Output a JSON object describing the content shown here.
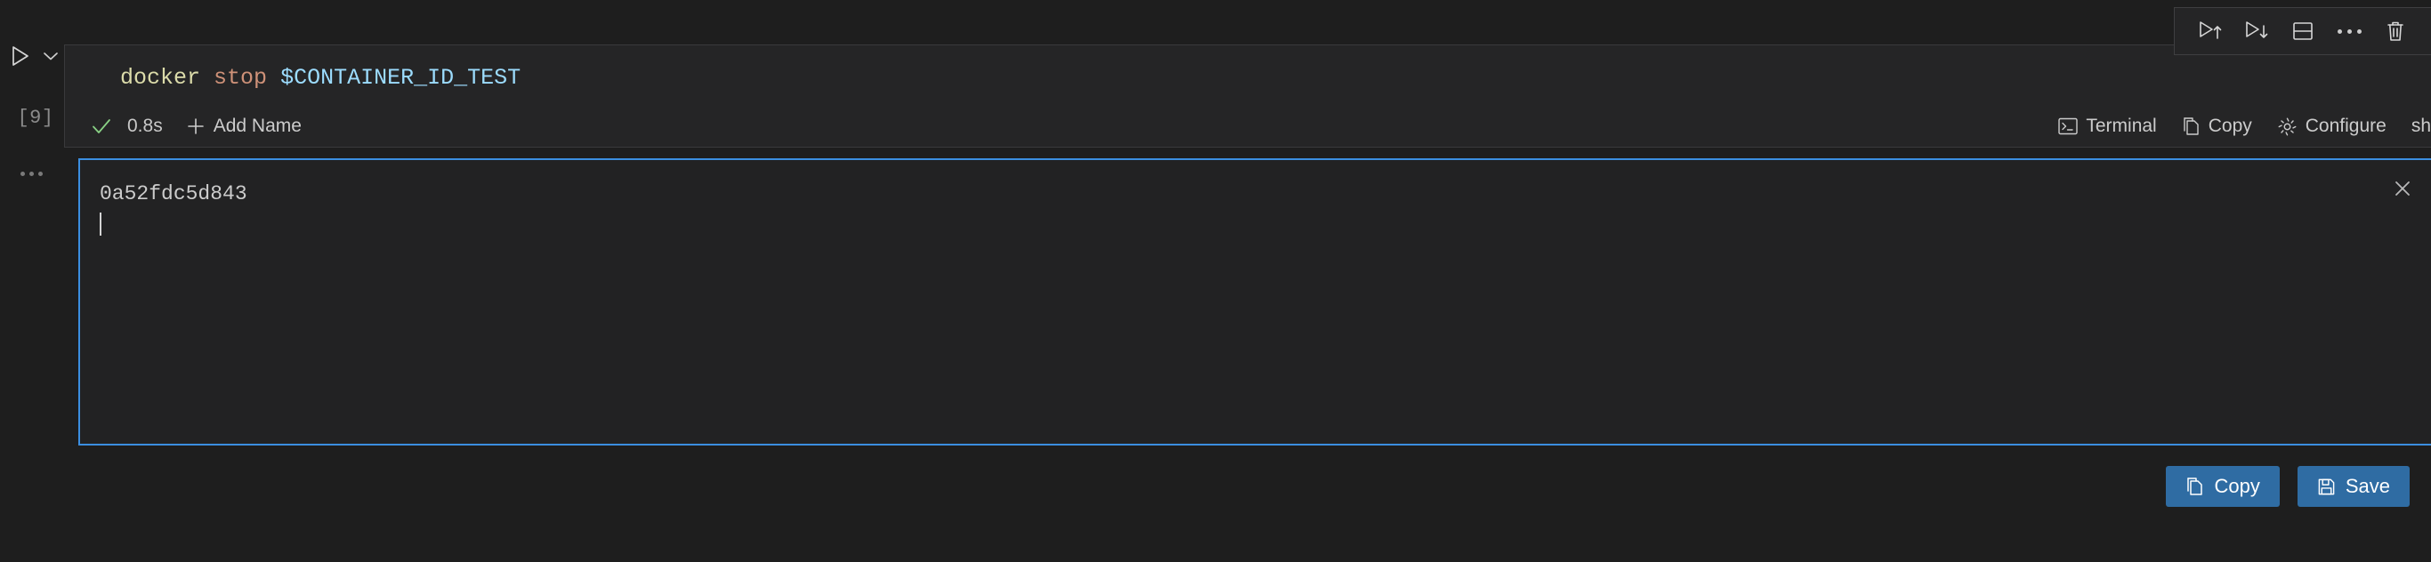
{
  "theme": {
    "page_bg": "#1e1e1e",
    "cell_bg": "#252526",
    "output_bg": "#222223",
    "focus_border": "#3b8ee0",
    "accent_button": "#2f6ca3",
    "text": "#cccccc",
    "muted_text": "#8b8b8b",
    "success": "#89d185",
    "syntax_command": "#dcdcaa",
    "syntax_argument": "#ce9178",
    "syntax_variable": "#9cdcfe"
  },
  "gutter": {
    "run_icon": "play-triangle-icon",
    "chevron_icon": "chevron-down-icon",
    "execution_count": "[9]",
    "more_icon": "ellipsis-icon"
  },
  "cell_toolbar": {
    "buttons": [
      {
        "name": "run-cells-above-button",
        "icon": "play-arrow-up-icon"
      },
      {
        "name": "run-cells-below-button",
        "icon": "play-arrow-down-icon"
      },
      {
        "name": "split-cell-button",
        "icon": "split-cell-icon"
      },
      {
        "name": "more-actions-button",
        "icon": "ellipsis-icon"
      },
      {
        "name": "delete-cell-button",
        "icon": "trash-icon"
      }
    ]
  },
  "code_cell": {
    "tokens": {
      "command": "docker",
      "argument": "stop",
      "variable": "$CONTAINER_ID_TEST"
    },
    "full_text": "docker stop $CONTAINER_ID_TEST"
  },
  "cell_status": {
    "success_icon": "checkmark-icon",
    "duration": "0.8s",
    "add_name_icon": "plus-icon",
    "add_name_label": "Add Name",
    "terminal_icon": "terminal-icon",
    "terminal_label": "Terminal",
    "copy_icon": "copy-icon",
    "copy_label": "Copy",
    "configure_icon": "gear-icon",
    "configure_label": "Configure",
    "kernel_label": "sh"
  },
  "output": {
    "text": "0a52fdc5d843",
    "close_icon": "close-icon"
  },
  "actions": {
    "copy": {
      "label": "Copy",
      "icon": "copy-icon"
    },
    "save": {
      "label": "Save",
      "icon": "floppy-disk-icon"
    }
  }
}
